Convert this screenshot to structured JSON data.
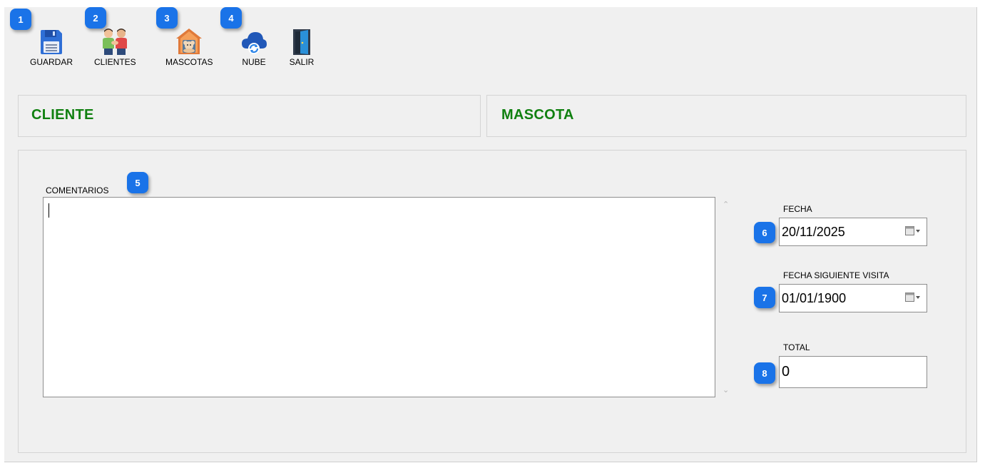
{
  "toolbar": {
    "items": [
      {
        "label": "GUARDAR",
        "icon": "floppy-disk-icon",
        "badge": "1"
      },
      {
        "label": "CLIENTES",
        "icon": "people-handshake-icon",
        "badge": "2"
      },
      {
        "label": "MASCOTAS",
        "icon": "pet-house-icon",
        "badge": "3"
      },
      {
        "label": "NUBE",
        "icon": "cloud-sync-icon",
        "badge": "4"
      },
      {
        "label": "SALIR",
        "icon": "exit-door-icon",
        "badge": ""
      }
    ]
  },
  "panels": {
    "cliente_title": "CLIENTE",
    "mascota_title": "MASCOTA"
  },
  "form": {
    "comentarios_label": "COMENTARIOS",
    "comentarios_badge": "5",
    "comentarios_value": "",
    "fecha_label": "FECHA",
    "fecha_value": "20/11/2025",
    "fecha_badge": "6",
    "fecha_siguiente_label": "FECHA SIGUIENTE VISITA",
    "fecha_siguiente_value": "01/01/1900",
    "fecha_siguiente_badge": "7",
    "total_label": "TOTAL",
    "total_value": "0",
    "total_badge": "8"
  },
  "colors": {
    "accent_green": "#108010",
    "badge_blue": "#1a73e8"
  }
}
